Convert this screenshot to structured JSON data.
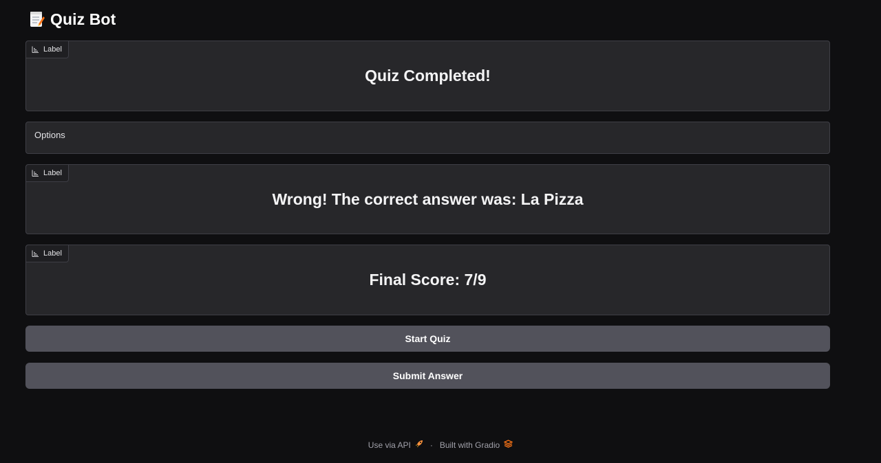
{
  "app": {
    "title": "Quiz Bot",
    "title_icon": "memo-icon"
  },
  "blocks": {
    "question": {
      "chip_label": "Label",
      "text": "Quiz Completed!"
    },
    "options": {
      "text": "Options"
    },
    "feedback": {
      "chip_label": "Label",
      "text": "Wrong! The correct answer was: La Pizza"
    },
    "score": {
      "chip_label": "Label",
      "text": "Final Score: 7/9"
    }
  },
  "buttons": {
    "start": "Start Quiz",
    "submit": "Submit Answer"
  },
  "footer": {
    "api_link": "Use via API",
    "api_icon": "rocket-icon",
    "separator": "·",
    "built_with": "Built with Gradio",
    "gradio_icon": "gradio-logo-icon"
  },
  "colors": {
    "background": "#0f0f11",
    "block_bg": "#27272a",
    "block_border": "#3f3f46",
    "button_bg": "#52525b",
    "accent_orange": "#f97316"
  }
}
